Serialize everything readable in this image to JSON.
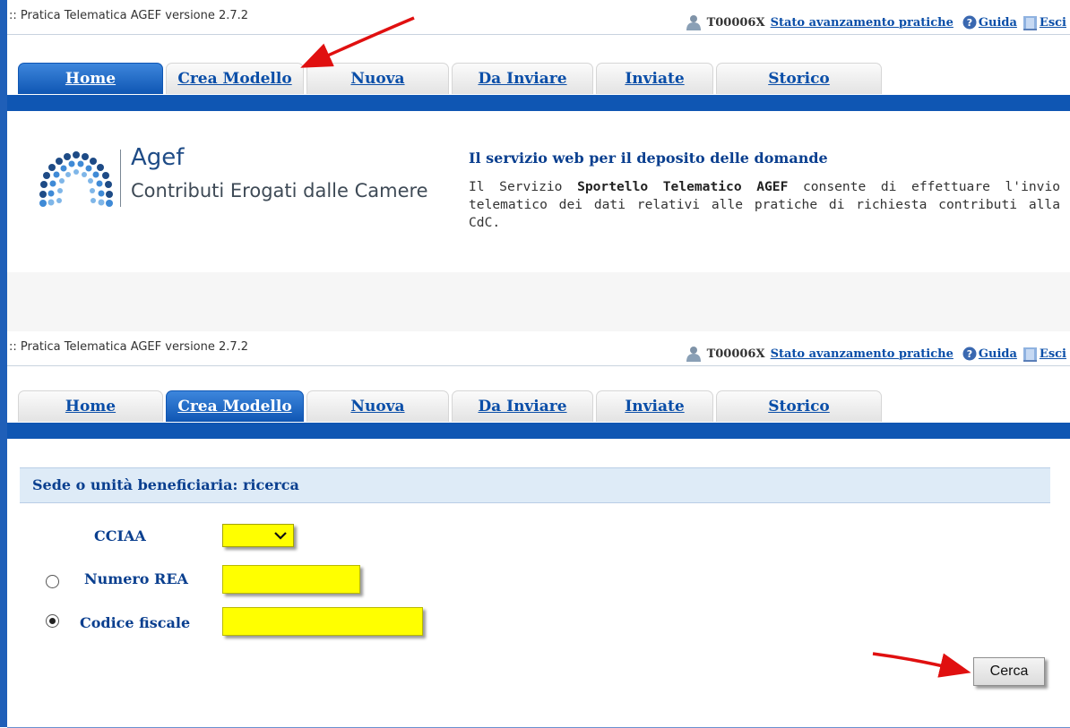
{
  "app_title": ":: Pratica Telematica AGEF versione 2.7.2",
  "user": {
    "id": "T00006X",
    "status_link": "Stato avanzamento pratiche",
    "help_link": "Guida",
    "exit_link": "Esci"
  },
  "tabs": [
    "Home",
    "Crea Modello",
    "Nuova",
    "Da Inviare",
    "Inviate",
    "Storico"
  ],
  "home": {
    "logo_name": "Agef",
    "logo_subtitle": "Contributi Erogati dalle Camere",
    "service_title": "Il servizio web per il deposito delle domande",
    "service_text_pre": "Il Servizio ",
    "service_text_bold": "Sportello Telematico AGEF",
    "service_text_post": " consente di effettuare l'invio telematico dei dati relativi alle pratiche di richiesta contributi alla CdC."
  },
  "search": {
    "section_title": "Sede o unità beneficiaria: ricerca",
    "cciaa_label": "CCIAA",
    "rea_label": "Numero REA",
    "cf_label": "Codice fiscale",
    "selected_option": "codice_fiscale",
    "submit_label": "Cerca"
  },
  "colors": {
    "brand_blue": "#0f56b3",
    "link_blue": "#0a4ea8",
    "field_yellow": "#ffff00",
    "arrow_red": "#e01010"
  }
}
